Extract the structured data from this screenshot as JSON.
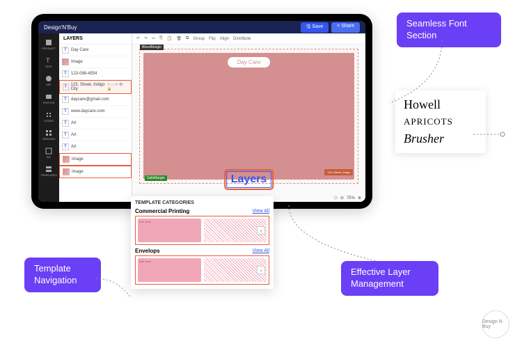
{
  "brand": "Design'N'Buy",
  "topbar": {
    "save": "Save",
    "share": "Share"
  },
  "sidebar": [
    "PRODUCT",
    "TEXT",
    "ART",
    "PHOTOS",
    "CODES",
    "DESIGNS",
    "BG",
    "TEMPLATES"
  ],
  "layers": {
    "title": "LAYERS",
    "items": [
      {
        "type": "T",
        "label": "Day Care"
      },
      {
        "type": "img",
        "label": "Image"
      },
      {
        "type": "T",
        "label": "123-098-4554"
      },
      {
        "type": "T",
        "label": "123, Street, Indigo City",
        "selected": true
      },
      {
        "type": "T",
        "label": "daycare@gmail.com"
      },
      {
        "type": "T",
        "label": "www.daycare.com"
      },
      {
        "type": "T",
        "label": "Art"
      },
      {
        "type": "T",
        "label": "Art"
      },
      {
        "type": "T",
        "label": "Art"
      },
      {
        "type": "img",
        "label": "Image",
        "hl": true
      },
      {
        "type": "img",
        "label": "Image",
        "hl": true
      }
    ]
  },
  "toolbar": {
    "group": "Group",
    "flip": "Flip",
    "align": "Align",
    "distribute": "Distribute"
  },
  "canvas": {
    "bleed": "BleedMargin",
    "safe": "SafeMargin",
    "logo": "Day Care",
    "addr": "123, Street, Indigo",
    "layersbtn": "Layers",
    "zoom": "75%"
  },
  "templates": {
    "title": "TEMPLATE CATEGORIES",
    "cats": [
      {
        "name": "Commercial Printing",
        "viewall": "View All",
        "sample": "Arie Jane"
      },
      {
        "name": "Envelops",
        "viewall": "View All",
        "sample": "Arie Jane"
      }
    ]
  },
  "callouts": {
    "font": "Seamless Font Section",
    "tpl": "Template Navigation",
    "layer": "Effective Layer Management"
  },
  "fonts": [
    "Howell",
    "APRICOTS",
    "Brusher"
  ],
  "badge": "Design N Buy"
}
